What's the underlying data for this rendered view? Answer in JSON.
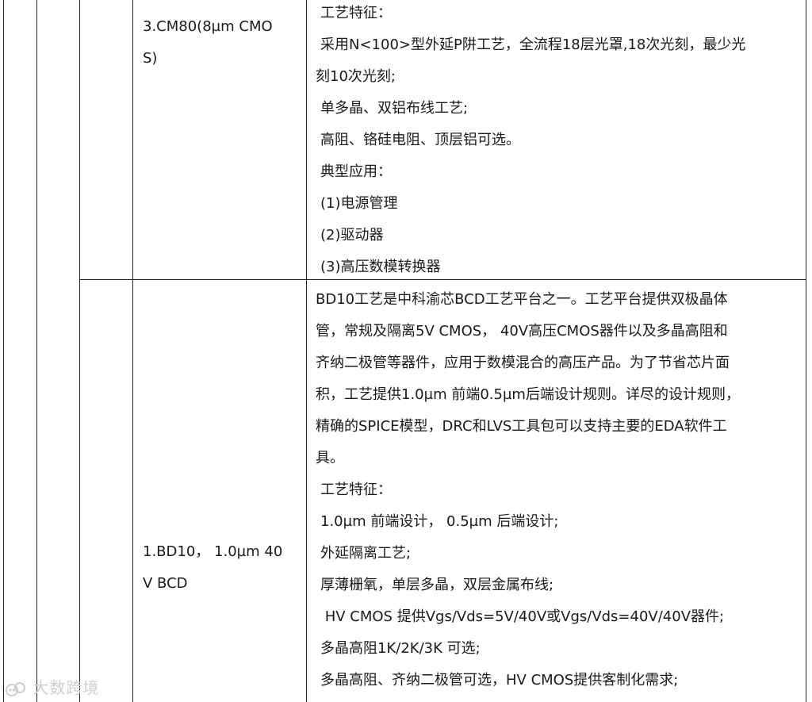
{
  "row1": {
    "name": [
      "3.CM80(8µm",
      "CMO",
      "S)"
    ],
    "lines": [
      "工艺特征：",
      "采用N<100>型外延P阱工艺，全流程18层光罩,18次光刻，最少光",
      "刻10次光刻;",
      "单多晶、双铝布线工艺;",
      "高阻、铬硅电阻、顶层铝可选。",
      "典型应用：",
      "(1)电源管理",
      "(2)驱动器",
      "(3)高压数模转换器"
    ]
  },
  "row2": {
    "name": [
      "1.BD10，",
      "1.0µm",
      "40",
      "V BCD"
    ],
    "lines": [
      "BD10工艺是中科渝芯BCD工艺平台之一。工艺平台提供双极晶体",
      "管，常规及隔离5V CMOS， 40V高压CMOS器件以及多晶高阻和",
      "齐纳二极管等器件，应用于数模混合的高压产品。为了节省芯片面",
      "积，工艺提供1.0µm 前端0.5µm后端设计规则。详尽的设计规则，",
      "精确的SPICE模型，DRC和LVS工具包可以支持主要的EDA软件工",
      "具。",
      "工艺特征：",
      "1.0µm 前端设计，  0.5µm 后端设计;",
      "外延隔离工艺;",
      "厚薄栅氧，单层多晶，双层金属布线;",
      " HV CMOS 提供Vgs/Vds=5V/40V或Vgs/Vds=40V/40V器件;",
      "多晶高阻1K/2K/3K 可选;",
      "多晶高阻、齐纳二极管可选，HV CMOS提供客制化需求;"
    ]
  },
  "watermark": "大数跨境"
}
